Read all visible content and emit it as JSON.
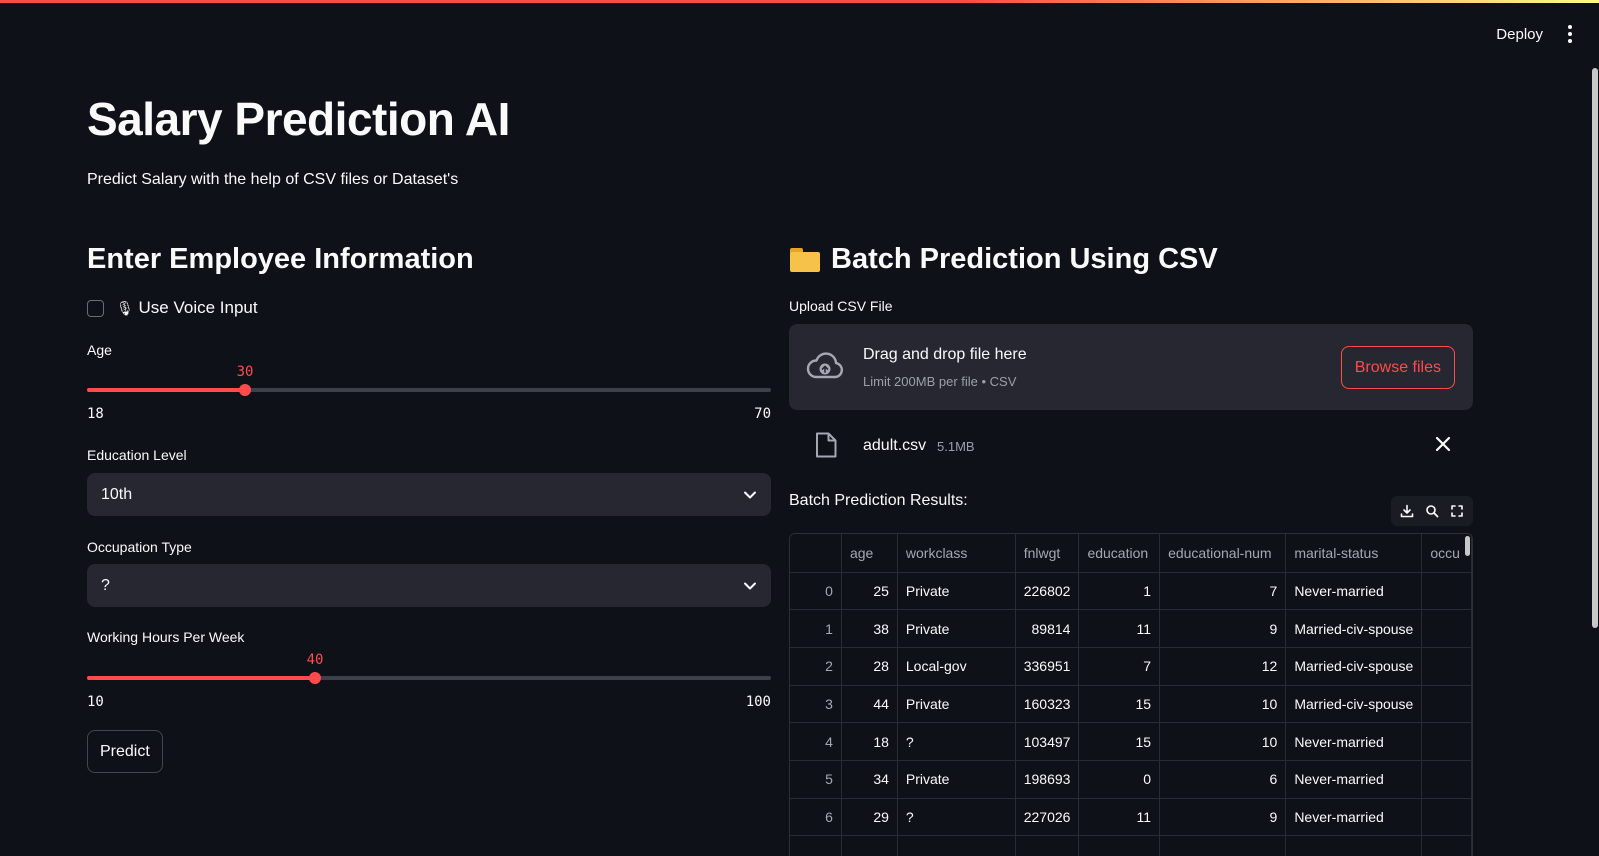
{
  "header": {
    "deploy_label": "Deploy"
  },
  "page": {
    "title": "Salary Prediction AI",
    "subtitle": "Predict Salary with the help of CSV files or Dataset's"
  },
  "left": {
    "heading": "Enter Employee Information",
    "voice_checkbox": {
      "icon": "🎙",
      "label": "Use Voice Input",
      "checked": false
    },
    "age": {
      "label": "Age",
      "value": "30",
      "min": "18",
      "max": "70"
    },
    "education": {
      "label": "Education Level",
      "value": "10th"
    },
    "occupation": {
      "label": "Occupation Type",
      "value": "?"
    },
    "hours": {
      "label": "Working Hours Per Week",
      "value": "40",
      "min": "10",
      "max": "100"
    },
    "predict_label": "Predict"
  },
  "right": {
    "heading": "Batch Prediction Using CSV",
    "upload_label": "Upload CSV File",
    "dropzone": {
      "title": "Drag and drop file here",
      "subtitle": "Limit 200MB per file • CSV",
      "browse_label": "Browse files"
    },
    "file": {
      "name": "adult.csv",
      "size": "5.1MB"
    },
    "results_label": "Batch Prediction Results:",
    "table": {
      "columns": [
        "",
        "age",
        "workclass",
        "fnlwgt",
        "education",
        "educational-num",
        "marital-status",
        "occu"
      ],
      "rows": [
        [
          "0",
          "25",
          "Private",
          "226802",
          "1",
          "7",
          "Never-married",
          ""
        ],
        [
          "1",
          "38",
          "Private",
          "89814",
          "11",
          "9",
          "Married-civ-spouse",
          ""
        ],
        [
          "2",
          "28",
          "Local-gov",
          "336951",
          "7",
          "12",
          "Married-civ-spouse",
          ""
        ],
        [
          "3",
          "44",
          "Private",
          "160323",
          "15",
          "10",
          "Married-civ-spouse",
          ""
        ],
        [
          "4",
          "18",
          "?",
          "103497",
          "15",
          "10",
          "Never-married",
          ""
        ],
        [
          "5",
          "34",
          "Private",
          "198693",
          "0",
          "6",
          "Never-married",
          ""
        ],
        [
          "6",
          "29",
          "?",
          "227026",
          "11",
          "9",
          "Never-married",
          ""
        ],
        [
          "",
          "",
          "",
          "",
          "",
          "",
          "",
          ""
        ]
      ]
    }
  },
  "colors": {
    "accent": "#ff4b4b",
    "background": "#0e1117",
    "widget": "#262730"
  }
}
